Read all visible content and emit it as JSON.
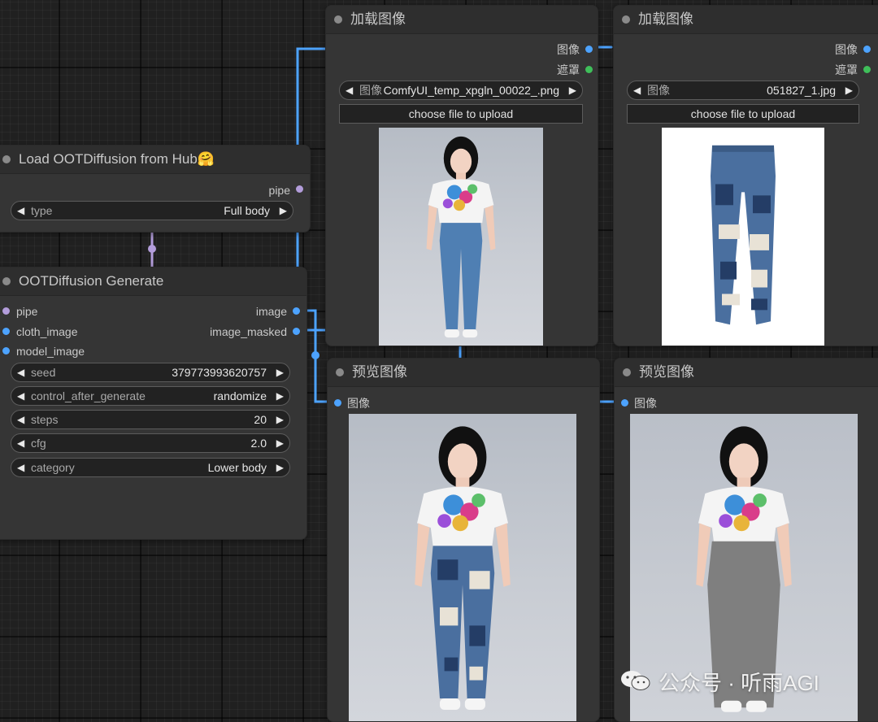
{
  "colors": {
    "image_link": "#4da3ff",
    "mask_link": "#3fbf5a",
    "pipe_link": "#b39ddb"
  },
  "nodes": {
    "load_hub": {
      "title": "Load OOTDiffusion from Hub🤗",
      "outputs": [
        "pipe"
      ],
      "widgets": [
        {
          "label": "type",
          "value": "Full body"
        }
      ]
    },
    "generate": {
      "title": "OOTDiffusion Generate",
      "inputs": [
        "pipe",
        "cloth_image",
        "model_image"
      ],
      "outputs": [
        "image",
        "image_masked"
      ],
      "widgets": [
        {
          "label": "seed",
          "value": "379773993620757"
        },
        {
          "label": "control_after_generate",
          "value": "randomize"
        },
        {
          "label": "steps",
          "value": "20"
        },
        {
          "label": "cfg",
          "value": "2.0"
        },
        {
          "label": "category",
          "value": "Lower body"
        }
      ]
    },
    "load_image_1": {
      "title": "加载图像",
      "outputs": [
        "图像",
        "遮罩"
      ],
      "widget": {
        "label": "图像",
        "value": "ComfyUI_temp_xpgln_00022_.png"
      },
      "upload_label": "choose file to upload"
    },
    "load_image_2": {
      "title": "加载图像",
      "outputs": [
        "图像",
        "遮罩"
      ],
      "widget": {
        "label": "图像",
        "value": "051827_1.jpg"
      },
      "upload_label": "choose file to upload"
    },
    "preview_1": {
      "title": "预览图像",
      "inputs": [
        "图像"
      ]
    },
    "preview_2": {
      "title": "预览图像",
      "inputs": [
        "图像"
      ]
    }
  },
  "watermark": "公众号 · 听雨AGI"
}
